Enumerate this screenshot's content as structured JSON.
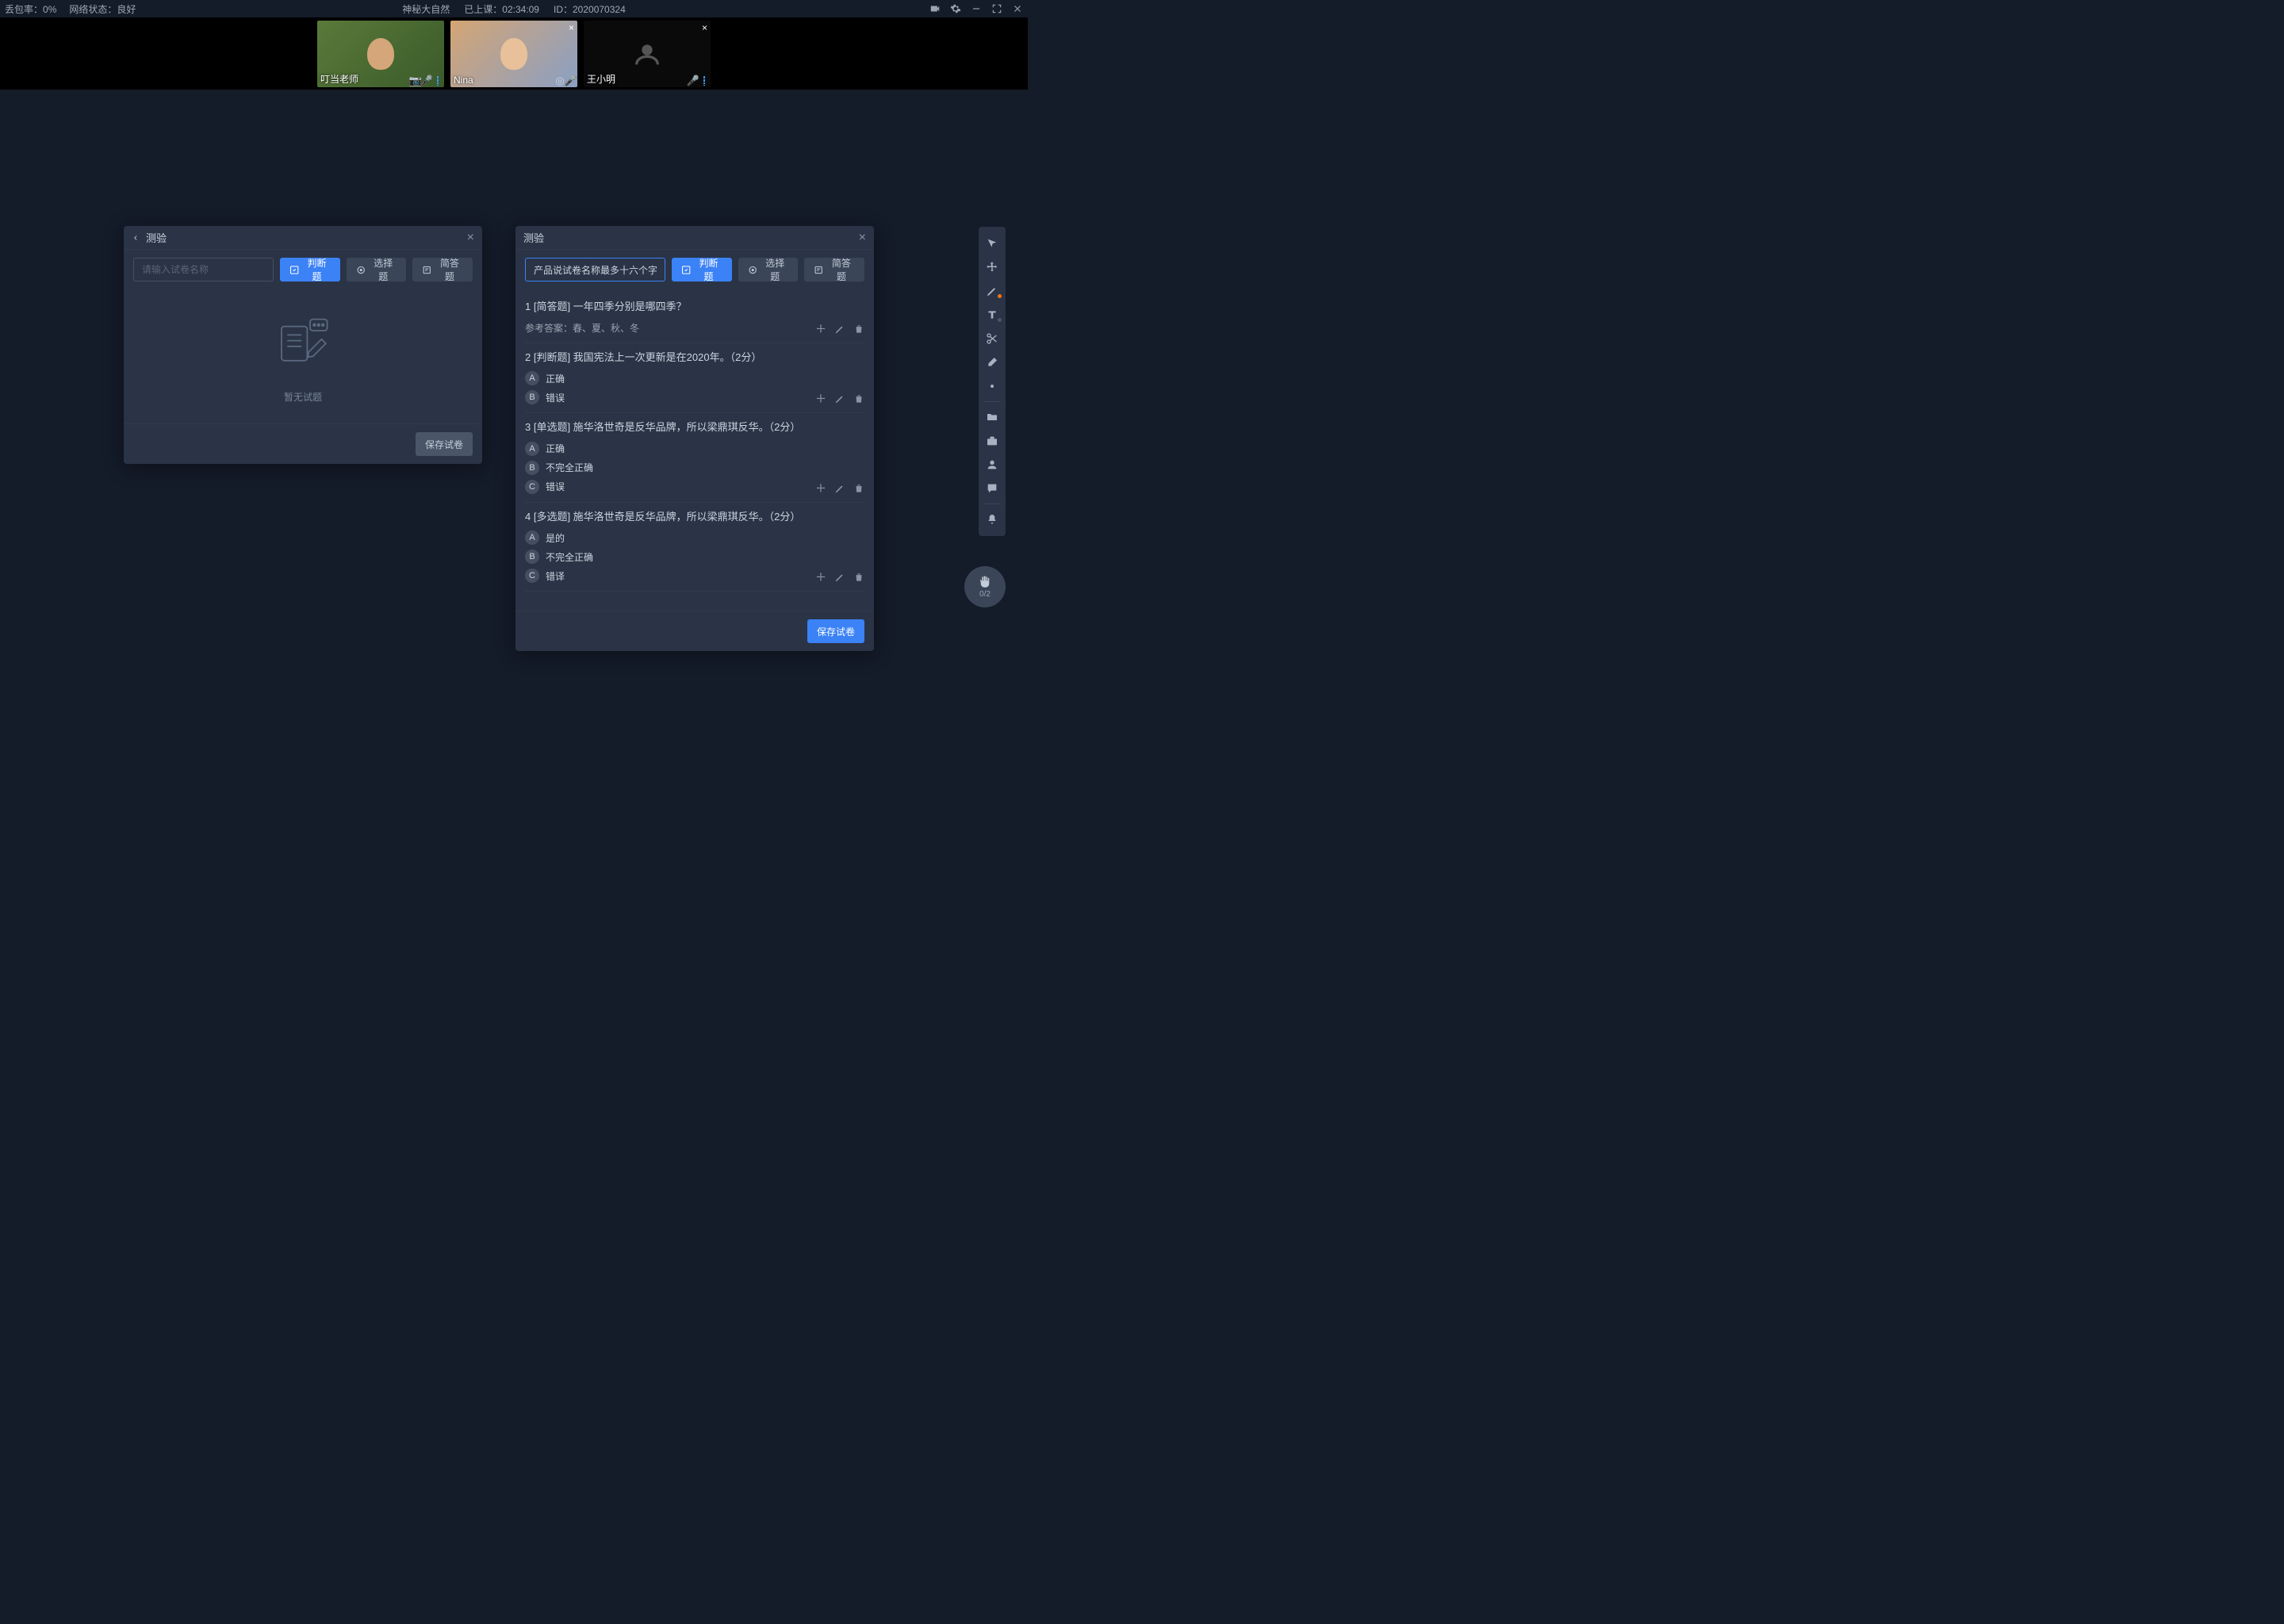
{
  "topbar": {
    "packet_loss_label": "丢包率：",
    "packet_loss_value": "0%",
    "network_label": "网络状态：",
    "network_value": "良好",
    "course_title": "神秘大自然",
    "elapsed_label": "已上课：",
    "elapsed_value": "02:34:09",
    "id_label": "ID：",
    "id_value": "2020070324"
  },
  "tiles": [
    {
      "name": "叮当老师",
      "camera_off": false
    },
    {
      "name": "Nina",
      "camera_off": false
    },
    {
      "name": "王小明",
      "camera_off": true
    }
  ],
  "left_panel": {
    "title": "测验",
    "search_placeholder": "请输入试卷名称",
    "btn_judge": "判断题",
    "btn_choice": "选择题",
    "btn_short": "简答题",
    "empty_text": "暂无试题",
    "save": "保存试卷"
  },
  "right_panel": {
    "title": "测验",
    "paper_name": "产品说试卷名称最多十六个字",
    "btn_judge": "判断题",
    "btn_choice": "选择题",
    "btn_short": "简答题",
    "save": "保存试卷",
    "questions": [
      {
        "no": "1",
        "type": "[简答题]",
        "text": "一年四季分别是哪四季？",
        "answer_label": "参考答案：",
        "answer": "春、夏、秋、冬",
        "options": []
      },
      {
        "no": "2",
        "type": "[判断题]",
        "text": "我国宪法上一次更新是在2020年。",
        "score": "（2分）",
        "options": [
          {
            "l": "A",
            "t": "正确"
          },
          {
            "l": "B",
            "t": "错误"
          }
        ]
      },
      {
        "no": "3",
        "type": "[单选题]",
        "text": "施华洛世奇是反华品牌，所以梁鼎琪反华。",
        "score": "（2分）",
        "options": [
          {
            "l": "A",
            "t": "正确"
          },
          {
            "l": "B",
            "t": "不完全正确"
          },
          {
            "l": "C",
            "t": "错误"
          }
        ]
      },
      {
        "no": "4",
        "type": "[多选题]",
        "text": "施华洛世奇是反华品牌，所以梁鼎琪反华。",
        "score": "（2分）",
        "options": [
          {
            "l": "A",
            "t": "是的"
          },
          {
            "l": "B",
            "t": "不完全正确"
          },
          {
            "l": "C",
            "t": "错译"
          }
        ]
      }
    ]
  },
  "hand": {
    "count": "0/2"
  }
}
